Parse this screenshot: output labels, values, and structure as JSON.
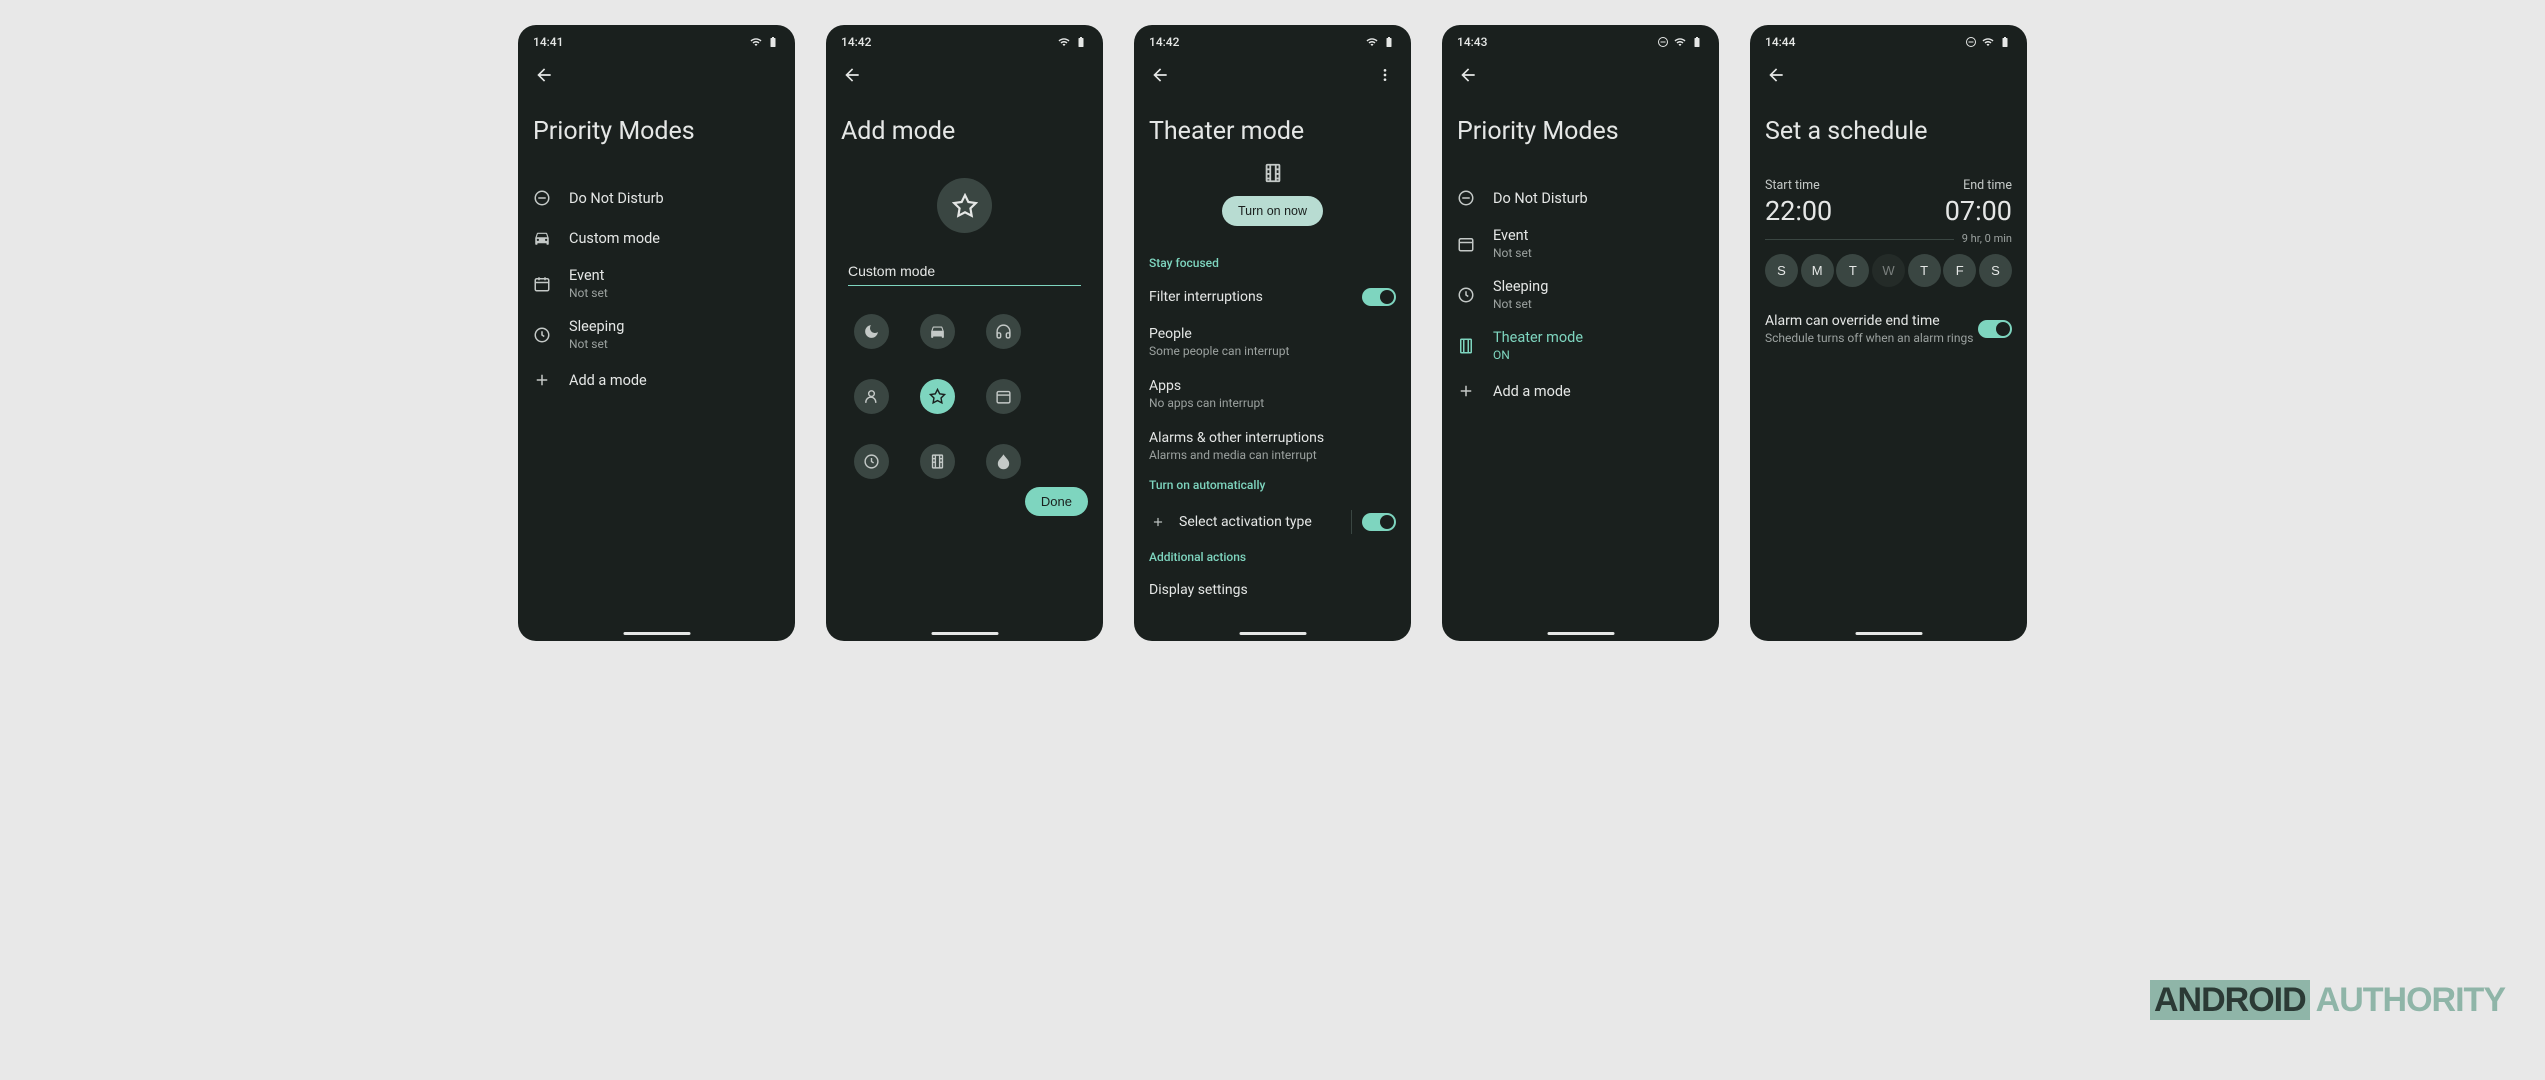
{
  "watermark": {
    "part1": "ANDROID",
    "part2": "AUTHORITY"
  },
  "screens": [
    {
      "time": "14:41",
      "title": "Priority Modes",
      "rows": [
        {
          "icon": "dnd",
          "title": "Do Not Disturb"
        },
        {
          "icon": "car",
          "title": "Custom mode"
        },
        {
          "icon": "calendar",
          "title": "Event",
          "sub": "Not set"
        },
        {
          "icon": "clock",
          "title": "Sleeping",
          "sub": "Not set"
        },
        {
          "icon": "plus",
          "title": "Add a mode"
        }
      ]
    },
    {
      "time": "14:42",
      "title": "Add mode",
      "input_value": "Custom mode",
      "done_label": "Done",
      "icons": [
        "moon",
        "car",
        "headphones",
        "person",
        "star",
        "calendar",
        "clock",
        "theater",
        "leaf"
      ]
    },
    {
      "time": "14:42",
      "title": "Theater mode",
      "turn_on_label": "Turn on now",
      "section1": "Stay focused",
      "filter": {
        "title": "Filter interruptions"
      },
      "people": {
        "title": "People",
        "sub": "Some people can interrupt"
      },
      "apps": {
        "title": "Apps",
        "sub": "No apps can interrupt"
      },
      "alarms": {
        "title": "Alarms & other interruptions",
        "sub": "Alarms and media can interrupt"
      },
      "section2": "Turn on automatically",
      "activation": {
        "title": "Select activation type"
      },
      "section3": "Additional actions",
      "display": {
        "title": "Display settings"
      }
    },
    {
      "time": "14:43",
      "title": "Priority Modes",
      "rows": [
        {
          "icon": "dnd",
          "title": "Do Not Disturb"
        },
        {
          "icon": "calendar",
          "title": "Event",
          "sub": "Not set"
        },
        {
          "icon": "clock",
          "title": "Sleeping",
          "sub": "Not set"
        },
        {
          "icon": "theater",
          "title": "Theater mode",
          "sub": "ON",
          "accent": true
        },
        {
          "icon": "plus",
          "title": "Add a mode"
        }
      ]
    },
    {
      "time": "14:44",
      "title": "Set a schedule",
      "start_label": "Start time",
      "start_value": "22:00",
      "end_label": "End time",
      "end_value": "07:00",
      "duration": "9 hr, 0 min",
      "days": [
        {
          "l": "S",
          "on": true
        },
        {
          "l": "M",
          "on": true
        },
        {
          "l": "T",
          "on": true
        },
        {
          "l": "W",
          "on": false
        },
        {
          "l": "T",
          "on": true
        },
        {
          "l": "F",
          "on": true
        },
        {
          "l": "S",
          "on": true
        }
      ],
      "alarm": {
        "title": "Alarm can override end time",
        "sub": "Schedule turns off when an alarm rings"
      }
    }
  ]
}
